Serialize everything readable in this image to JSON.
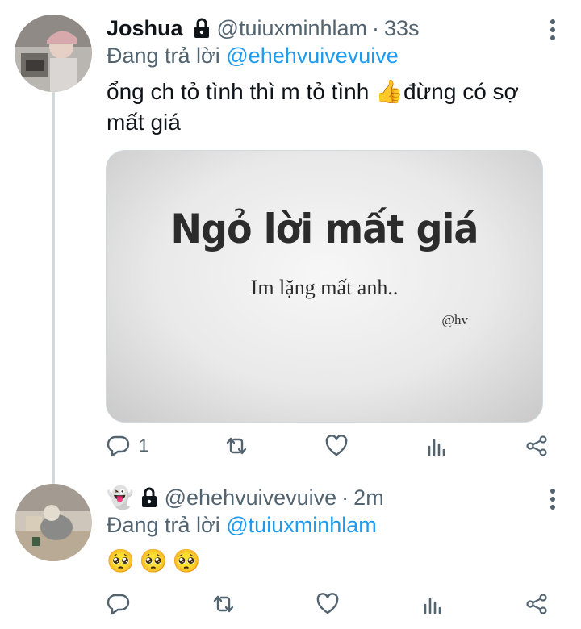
{
  "colors": {
    "accent": "#1d9bf0",
    "muted": "#536471",
    "text": "#0f1419",
    "thread_line": "#cfd9de"
  },
  "tweets": [
    {
      "display_name": "Joshua",
      "handle": "@tuiuxminhlam",
      "separator": "·",
      "time": "33s",
      "reply_prefix": "Đang trả lời ",
      "reply_to": "@ehehvuivevuive",
      "text": "ổng ch tỏ tình thì m tỏ tình 👍đừng có sợ mất giá",
      "media": {
        "title": "Ngỏ lời mất giá",
        "subtitle": "Im lặng mất anh..",
        "credit": "@hv"
      },
      "actions": {
        "reply_count": "1"
      },
      "icons": [
        "lock-icon",
        "more-icon",
        "reply-icon",
        "retweet-icon",
        "like-icon",
        "analytics-icon",
        "share-icon"
      ]
    },
    {
      "display_name_emoji": "👻",
      "handle": "@ehehvuivevuive",
      "separator": "·",
      "time": "2m",
      "reply_prefix": "Đang trả lời ",
      "reply_to": "@tuiuxminhlam",
      "emojis": [
        "🥺",
        "🥺",
        "🥺"
      ],
      "icons": [
        "lock-icon",
        "more-icon",
        "reply-icon",
        "retweet-icon",
        "like-icon",
        "analytics-icon",
        "share-icon"
      ]
    }
  ]
}
